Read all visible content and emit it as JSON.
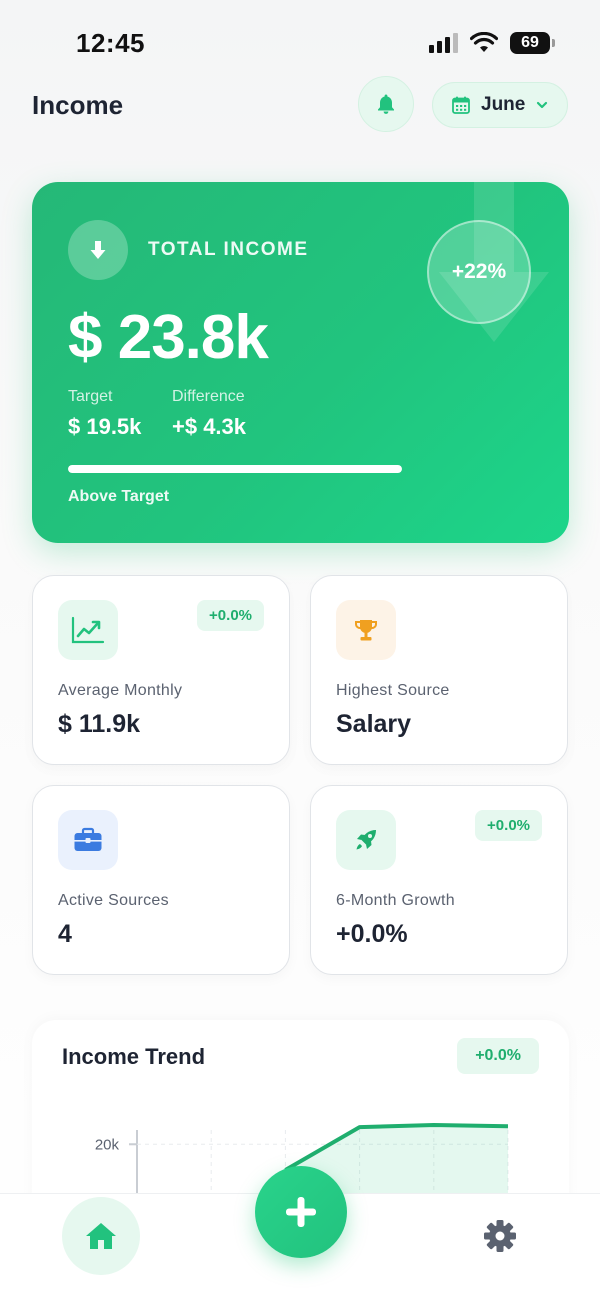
{
  "status_bar": {
    "time": "12:45",
    "battery": "69"
  },
  "header": {
    "title": "Income",
    "month": "June",
    "icons": {
      "bell": "bell-icon",
      "calendar": "calendar-icon",
      "chevron": "chevron-down-icon"
    }
  },
  "hero": {
    "label": "TOTAL INCOME",
    "amount": "$ 23.8k",
    "change_badge": "+22%",
    "target_label": "Target",
    "target_value": "$ 19.5k",
    "difference_label": "Difference",
    "difference_value": "+$ 4.3k",
    "progress_percent": 100,
    "status": "Above Target",
    "icon": "arrow-down-icon"
  },
  "stats": [
    {
      "label": "Average Monthly",
      "value": "$ 11.9k",
      "badge": "+0.0%",
      "icon": "chart-line-icon",
      "icon_bg": "#e6f8ef",
      "icon_color": "#22c27e"
    },
    {
      "label": "Highest Source",
      "value": "Salary",
      "badge": "",
      "icon": "trophy-icon",
      "icon_bg": "#fdf3e7",
      "icon_color": "#f0a020"
    },
    {
      "label": "Active Sources",
      "value": "4",
      "badge": "",
      "icon": "briefcase-icon",
      "icon_bg": "#eaf1fd",
      "icon_color": "#3b7be0"
    },
    {
      "label": "6-Month Growth",
      "value": "+0.0%",
      "badge": "+0.0%",
      "icon": "rocket-icon",
      "icon_bg": "#e6f8ef",
      "icon_color": "#1fae6e"
    }
  ],
  "trend": {
    "title": "Income Trend",
    "badge": "+0.0%"
  },
  "chart_data": {
    "type": "area",
    "title": "Income Trend",
    "tick_labels": [
      "20k"
    ],
    "y_ticks": [
      20000
    ],
    "x": [
      0,
      1,
      2,
      3,
      4,
      5
    ],
    "values": [
      null,
      null,
      14000,
      24000,
      24500,
      24200
    ],
    "grid": true
  },
  "nav": {
    "home_icon": "home-icon",
    "add_icon": "plus-icon",
    "settings_icon": "gear-icon"
  },
  "colors": {
    "accent": "#22c27e",
    "accent_light": "#e6f8ef",
    "text": "#1e2433",
    "muted": "#5b6270"
  }
}
